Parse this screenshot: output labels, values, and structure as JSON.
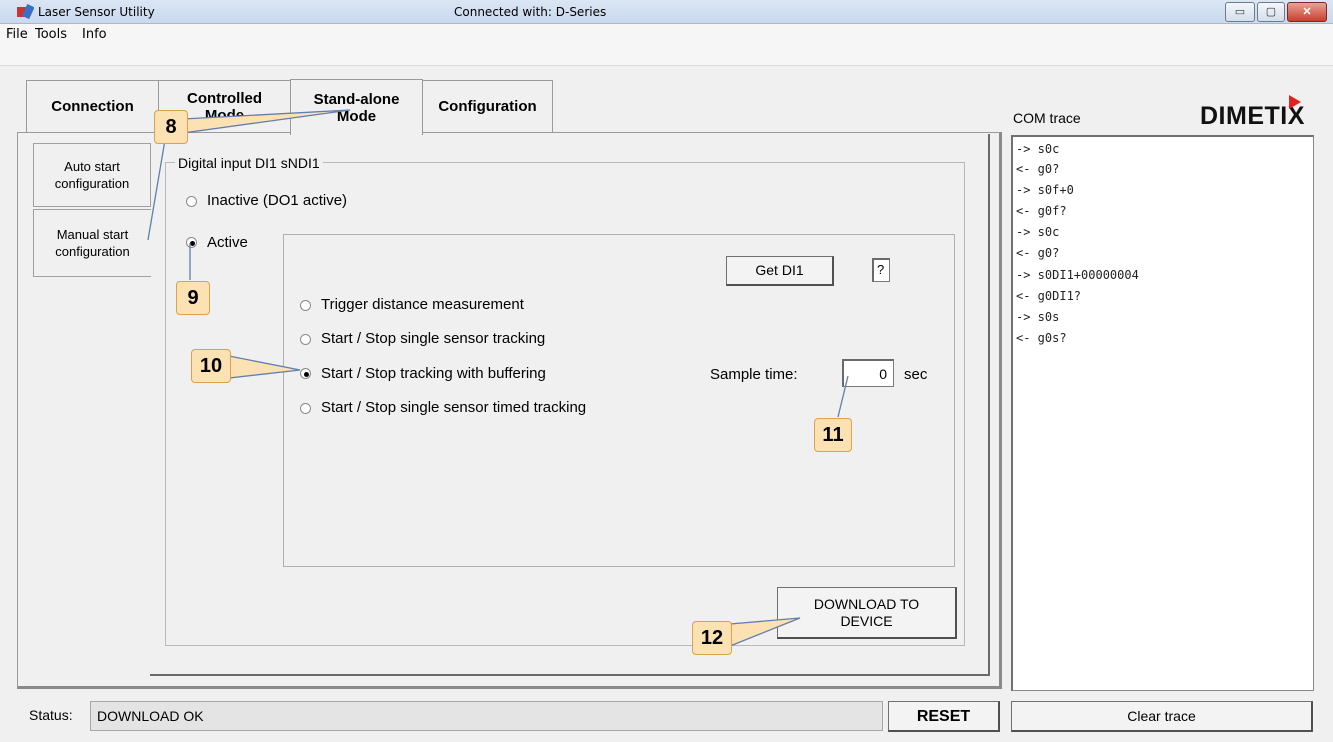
{
  "window": {
    "title": "Laser Sensor Utility",
    "connection_status": "Connected with: D-Series",
    "buttons": {
      "minimize": "▭",
      "maximize": "▢",
      "close": "✕"
    }
  },
  "menu": {
    "items": [
      "File",
      "Tools",
      "Info"
    ]
  },
  "tabs": [
    {
      "line1": "Connection",
      "line2": ""
    },
    {
      "line1": "Controlled",
      "line2": "Mode"
    },
    {
      "line1": "Stand-alone",
      "line2": "Mode"
    },
    {
      "line1": "Configuration",
      "line2": ""
    }
  ],
  "side_tabs": [
    {
      "line1": "Auto start",
      "line2": "configuration"
    },
    {
      "line1": "Manual start",
      "line2": "configuration"
    }
  ],
  "group": {
    "legend": "Digital input DI1 sNDI1",
    "mode_options": [
      {
        "label": "Inactive (DO1 active)",
        "selected": false
      },
      {
        "label": "Active",
        "selected": true
      }
    ],
    "get_button": "Get DI1",
    "di_value": "?",
    "functions": [
      {
        "label": "Trigger distance measurement",
        "selected": false
      },
      {
        "label": "Start / Stop single sensor tracking",
        "selected": false
      },
      {
        "label": "Start / Stop tracking with buffering",
        "selected": true
      },
      {
        "label": "Start / Stop single sensor timed tracking",
        "selected": false
      }
    ],
    "sample_time_label": "Sample time:",
    "sample_time_value": "0",
    "sample_time_unit": "sec",
    "download_line1": "DOWNLOAD TO",
    "download_line2": "DEVICE"
  },
  "callouts": [
    "8",
    "9",
    "10",
    "11",
    "12"
  ],
  "com_trace": {
    "label": "COM trace",
    "logo": "DIMETIX",
    "lines": [
      "-> s0c",
      "<- g0?",
      "-> s0f+0",
      "<- g0f?",
      "-> s0c",
      "<- g0?",
      "-> s0DI1+00000004",
      "<- g0DI1?",
      "-> s0s",
      "<- g0s?"
    ],
    "clear_button": "Clear trace"
  },
  "status": {
    "label": "Status:",
    "value": "DOWNLOAD OK",
    "reset_button": "RESET"
  },
  "colors": {
    "callout_fill": "#fce1b3",
    "callout_border": "#d8a24e",
    "callout_line": "#5f7fae",
    "logo_accent": "#e0231f"
  }
}
